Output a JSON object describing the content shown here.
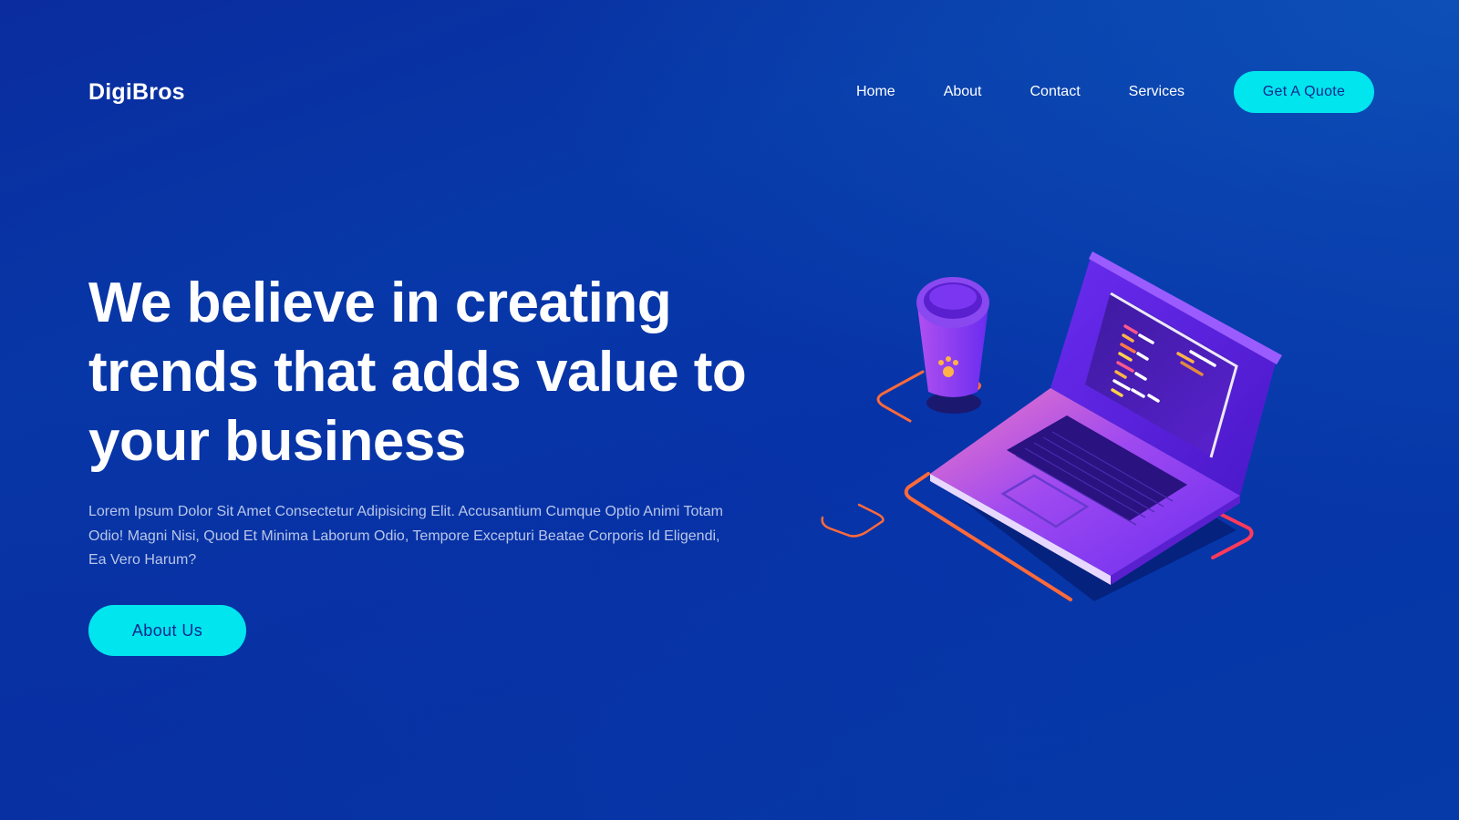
{
  "brand": {
    "name": "DigiBros"
  },
  "nav": {
    "items": [
      {
        "label": "Home"
      },
      {
        "label": "About"
      },
      {
        "label": "Contact"
      },
      {
        "label": "Services"
      }
    ],
    "cta_label": "Get A Quote"
  },
  "hero": {
    "title": "We believe in creating trends that adds value to your business",
    "description": "Lorem Ipsum Dolor Sit Amet Consectetur Adipisicing Elit. Accusantium Cumque Optio Animi Totam Odio! Magni Nisi, Quod Et Minima Laborum Odio, Tempore Excepturi Beatae Corporis Id Eligendi, Ea Vero Harum?",
    "button_label": "About Us",
    "illustration": "isometric-laptop-and-coffee-cup"
  },
  "colors": {
    "background": "#0733a8",
    "accent": "#00e5ee",
    "button_text": "#0b2a8c",
    "body_text": "#b9c6e8",
    "illustration_purple": "#7a2cf0",
    "illustration_orange": "#ff6a3a"
  }
}
